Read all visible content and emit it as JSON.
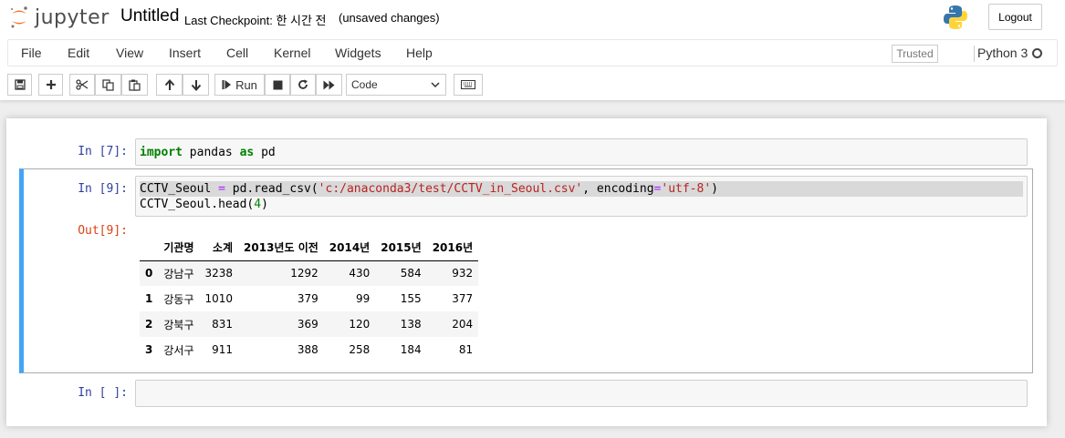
{
  "header": {
    "logo_text": "jupyter",
    "notebook_name": "Untitled",
    "checkpoint": "Last Checkpoint: 한 시간 전",
    "autosave_status": "(unsaved changes)",
    "logout_label": "Logout"
  },
  "menubar": {
    "items": [
      "File",
      "Edit",
      "View",
      "Insert",
      "Cell",
      "Kernel",
      "Widgets",
      "Help"
    ],
    "trusted_label": "Trusted",
    "kernel_name": "Python 3"
  },
  "toolbar": {
    "run_label": "Run",
    "cell_type": "Code",
    "buttons": [
      "save-icon",
      "plus-icon",
      "cut-icon",
      "copy-icon",
      "paste-icon",
      "arrow-up-icon",
      "arrow-down-icon",
      "step-forward-icon",
      "stop-icon",
      "restart-icon",
      "fast-forward-icon",
      "keyboard-icon"
    ]
  },
  "cells": [
    {
      "prompt": "In [7]:",
      "code_lines": [
        [
          [
            "kw",
            "import"
          ],
          [
            "plain",
            " pandas "
          ],
          [
            "kw",
            "as"
          ],
          [
            "plain",
            " pd"
          ]
        ]
      ]
    },
    {
      "prompt": "In [9]:",
      "out_prompt": "Out[9]:",
      "code_lines": [
        [
          [
            "plain",
            "CCTV_Seoul "
          ],
          [
            "op",
            "="
          ],
          [
            "plain",
            " pd.read_csv("
          ],
          [
            "str",
            "'c:/anaconda3/test/CCTV_in_Seoul.csv'"
          ],
          [
            "plain",
            ", encoding"
          ],
          [
            "op",
            "="
          ],
          [
            "str",
            "'utf-8'"
          ],
          [
            "plain",
            ")"
          ]
        ],
        [
          [
            "plain",
            "CCTV_Seoul.head("
          ],
          [
            "num",
            "4"
          ],
          [
            "plain",
            ")"
          ]
        ]
      ],
      "output_table": {
        "columns": [
          "",
          "기관명",
          "소계",
          "2013년도 이전",
          "2014년",
          "2015년",
          "2016년"
        ],
        "rows": [
          [
            "0",
            "강남구",
            "3238",
            "1292",
            "430",
            "584",
            "932"
          ],
          [
            "1",
            "강동구",
            "1010",
            "379",
            "99",
            "155",
            "377"
          ],
          [
            "2",
            "강북구",
            "831",
            "369",
            "120",
            "138",
            "204"
          ],
          [
            "3",
            "강서구",
            "911",
            "388",
            "258",
            "184",
            "81"
          ]
        ]
      }
    },
    {
      "prompt": "In [ ]:",
      "code_lines": []
    }
  ]
}
